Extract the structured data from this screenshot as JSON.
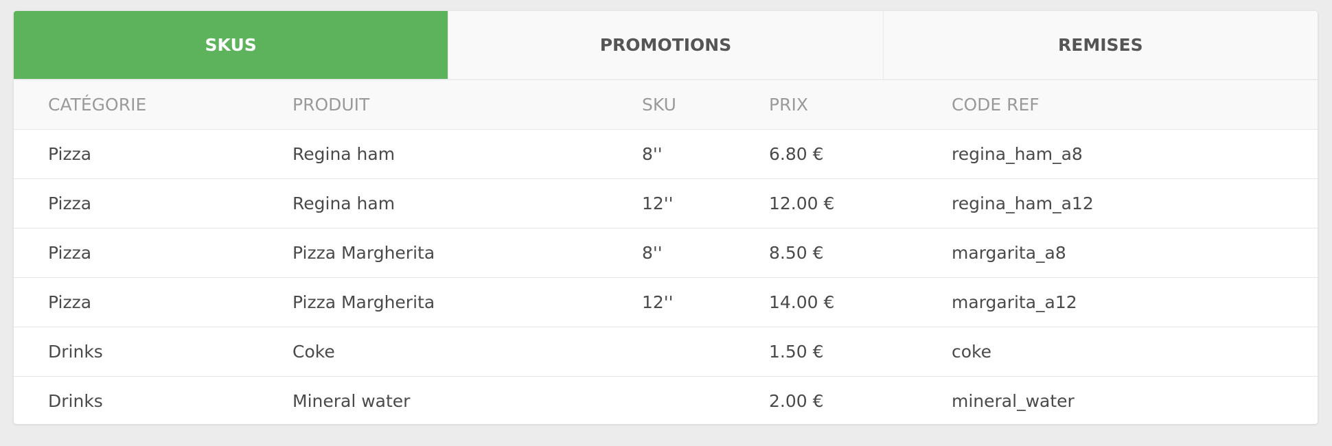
{
  "tabs": [
    {
      "label": "SKUS",
      "active": true
    },
    {
      "label": "PROMOTIONS",
      "active": false
    },
    {
      "label": "REMISES",
      "active": false
    }
  ],
  "table": {
    "headers": [
      "CATÉGORIE",
      "PRODUIT",
      "SKU",
      "PRIX",
      "CODE REF"
    ],
    "rows": [
      [
        "Pizza",
        "Regina ham",
        "8''",
        "6.80 €",
        "regina_ham_a8"
      ],
      [
        "Pizza",
        "Regina ham",
        "12''",
        "12.00 €",
        "regina_ham_a12"
      ],
      [
        "Pizza",
        "Pizza Margherita",
        "8''",
        "8.50 €",
        "margarita_a8"
      ],
      [
        "Pizza",
        "Pizza Margherita",
        "12''",
        "14.00 €",
        "margarita_a12"
      ],
      [
        "Drinks",
        "Coke",
        "",
        "1.50 €",
        "coke"
      ],
      [
        "Drinks",
        "Mineral water",
        "",
        "2.00 €",
        "mineral_water"
      ]
    ]
  },
  "colors": {
    "active_tab": "#5cb35c",
    "tab_bg": "#f9f9f9",
    "page_bg": "#ececec"
  }
}
